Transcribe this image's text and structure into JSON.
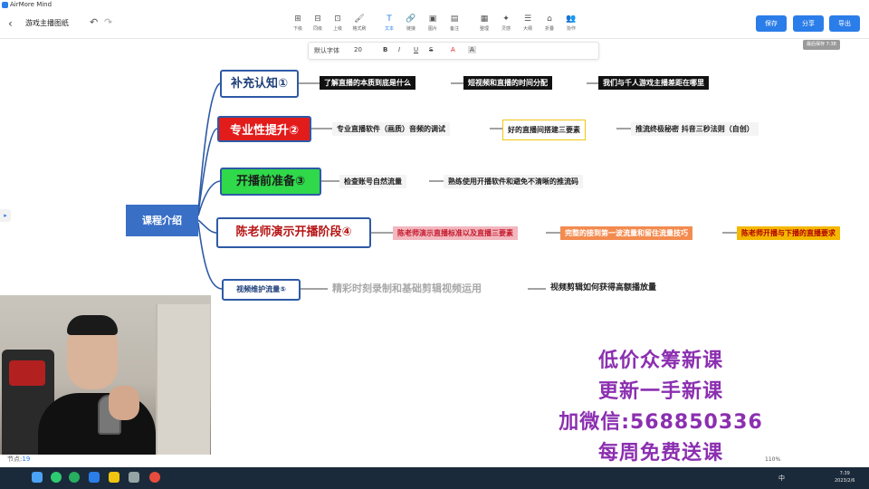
{
  "app": {
    "name": "AirMore Mind"
  },
  "toolbar": {
    "doc_title": "游戏主播图纸",
    "tools": [
      {
        "label": "下级",
        "icon": "subnode-icon"
      },
      {
        "label": "同级",
        "icon": "sibling-icon"
      },
      {
        "label": "上级",
        "icon": "parent-icon"
      },
      {
        "label": "格式刷",
        "icon": "format-brush-icon"
      },
      {
        "label": "文本",
        "icon": "text-icon",
        "active": true
      },
      {
        "label": "链接",
        "icon": "link-icon"
      },
      {
        "label": "图片",
        "icon": "image-icon"
      },
      {
        "label": "备注",
        "icon": "note-icon"
      },
      {
        "label": "整理",
        "icon": "arrange-icon"
      },
      {
        "label": "灵感",
        "icon": "idea-icon"
      },
      {
        "label": "大纲",
        "icon": "outline-icon"
      },
      {
        "label": "折叠",
        "icon": "collapse-icon"
      },
      {
        "label": "协作",
        "icon": "collab-icon"
      }
    ],
    "save": "保存",
    "share": "分享",
    "export": "导出",
    "autosave": "最后保存 7:38"
  },
  "format_bar": {
    "font": "默认字体",
    "size": "20",
    "bold": "B",
    "italic": "I",
    "underline": "U",
    "strike": "S",
    "font_color": "A",
    "highlight": "A"
  },
  "mindmap": {
    "root": "课程介绍",
    "branches": [
      {
        "label": "补充认知①",
        "leaves": [
          "了解直播的本质到底是什么",
          "短视频和直播的时间分配",
          "我们与千人游戏主播差距在哪里"
        ]
      },
      {
        "label": "专业性提升②",
        "leaves": [
          "专业直播软件（画质）音频的调试",
          "好的直播间搭建三要素",
          "推流终极秘密 抖音三秒法则（自创）"
        ]
      },
      {
        "label": "开播前准备③",
        "leaves": [
          "检查账号自然流量",
          "熟练使用开播软件和避免不清晰的推流码"
        ]
      },
      {
        "label": "陈老师演示开播阶段④",
        "leaves": [
          "陈老师演示直播标准以及直播三要素",
          "完整的接到第一波流量和留住流量技巧",
          "陈老师开播与下播的直播要求"
        ]
      },
      {
        "label": "视频维护流量⑤",
        "leaves": [
          "精彩时刻录制和基础剪辑视频运用",
          "视频剪辑如何获得高额播放量"
        ]
      }
    ]
  },
  "promo": [
    "低价众筹新课",
    "更新一手新课",
    "加微信:568850336",
    "每周免费送课"
  ],
  "status": {
    "nodes_label": "节点:",
    "nodes_count": "19",
    "zoom": "110%"
  },
  "taskbar": {
    "input_method": "中",
    "time": "7:39",
    "date": "2023/2/6"
  },
  "colors": {
    "accent": "#2b7de9",
    "branch_line": "#2e5aa6",
    "promo": "#8b2fb0"
  }
}
